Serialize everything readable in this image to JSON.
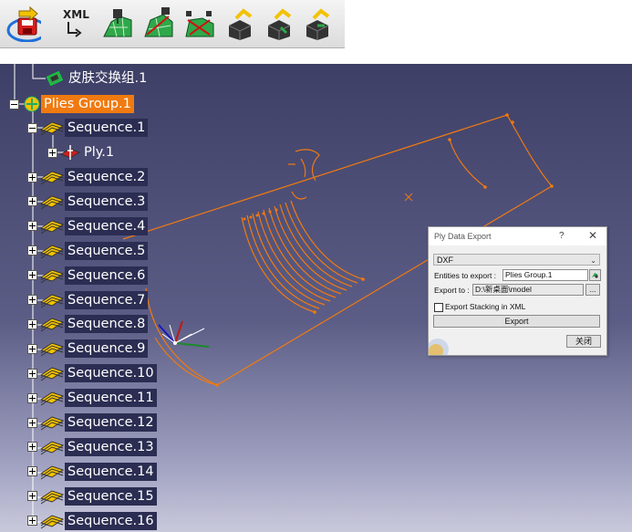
{
  "toolbar": {
    "buttons": [
      {
        "name": "export-ply-data",
        "selected": true
      },
      {
        "name": "xml-export",
        "text": "XML"
      },
      {
        "name": "tool-3"
      },
      {
        "name": "tool-4"
      },
      {
        "name": "tool-5"
      },
      {
        "name": "tool-6"
      },
      {
        "name": "tool-7"
      },
      {
        "name": "tool-8"
      }
    ],
    "highlight_color": "#1e6fd9"
  },
  "tree": {
    "top_item": "皮肤交换组.1",
    "root": "Plies Group.1",
    "sequence1": "Sequence.1",
    "ply1": "Ply.1",
    "sequences": [
      "Sequence.2",
      "Sequence.3",
      "Sequence.4",
      "Sequence.5",
      "Sequence.6",
      "Sequence.7",
      "Sequence.8",
      "Sequence.9",
      "Sequence.10",
      "Sequence.11",
      "Sequence.12",
      "Sequence.13",
      "Sequence.14",
      "Sequence.15",
      "Sequence.16"
    ]
  },
  "dialog": {
    "title": "Ply Data Export",
    "help": "?",
    "close_glyph": "✕",
    "format": "DXF",
    "entities_label": "Entities to export :",
    "entities_value": "Plies Group.1",
    "export_to_label": "Export to :",
    "export_to_value": "D:\\新桌面\\model",
    "browse": "...",
    "stacking_label": "Export Stacking in XML",
    "stacking_checked": false,
    "export_button": "Export",
    "close_button": "关闭"
  },
  "colors": {
    "geometry": "#f07a10",
    "selection": "#f07a10"
  }
}
